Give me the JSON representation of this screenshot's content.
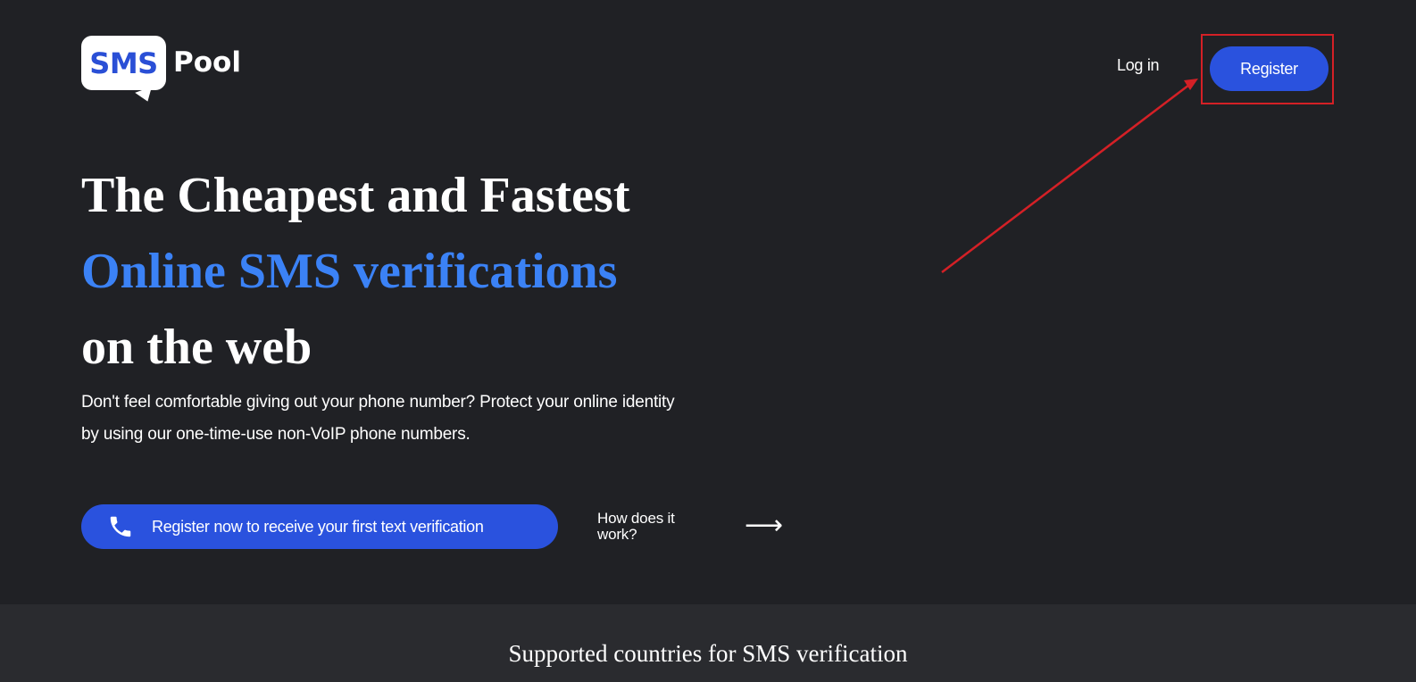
{
  "header": {
    "logo": {
      "sms": "SMS",
      "pool": "Pool",
      "icon": "chat-bubble-logo"
    },
    "login_label": "Log in",
    "register_label": "Register"
  },
  "hero": {
    "headline_line1": "The Cheapest and Fastest",
    "headline_line2": "Online SMS verifications",
    "headline_line3": "on the web",
    "subtext": "Don't feel comfortable giving out your phone number? Protect your online identity by using our one-time-use non-VoIP phone numbers.",
    "cta_label": "Register now to receive your first text verification",
    "cta_icon": "phone-icon",
    "how_label": "How does it work?",
    "how_icon": "arrow-right-icon"
  },
  "countries": {
    "title": "Supported countries for SMS verification"
  },
  "colors": {
    "background": "#202125",
    "section_background": "#2a2b2f",
    "accent_blue": "#2a52de",
    "headline_blue": "#3b82f6",
    "annotation_red": "#d42026"
  }
}
